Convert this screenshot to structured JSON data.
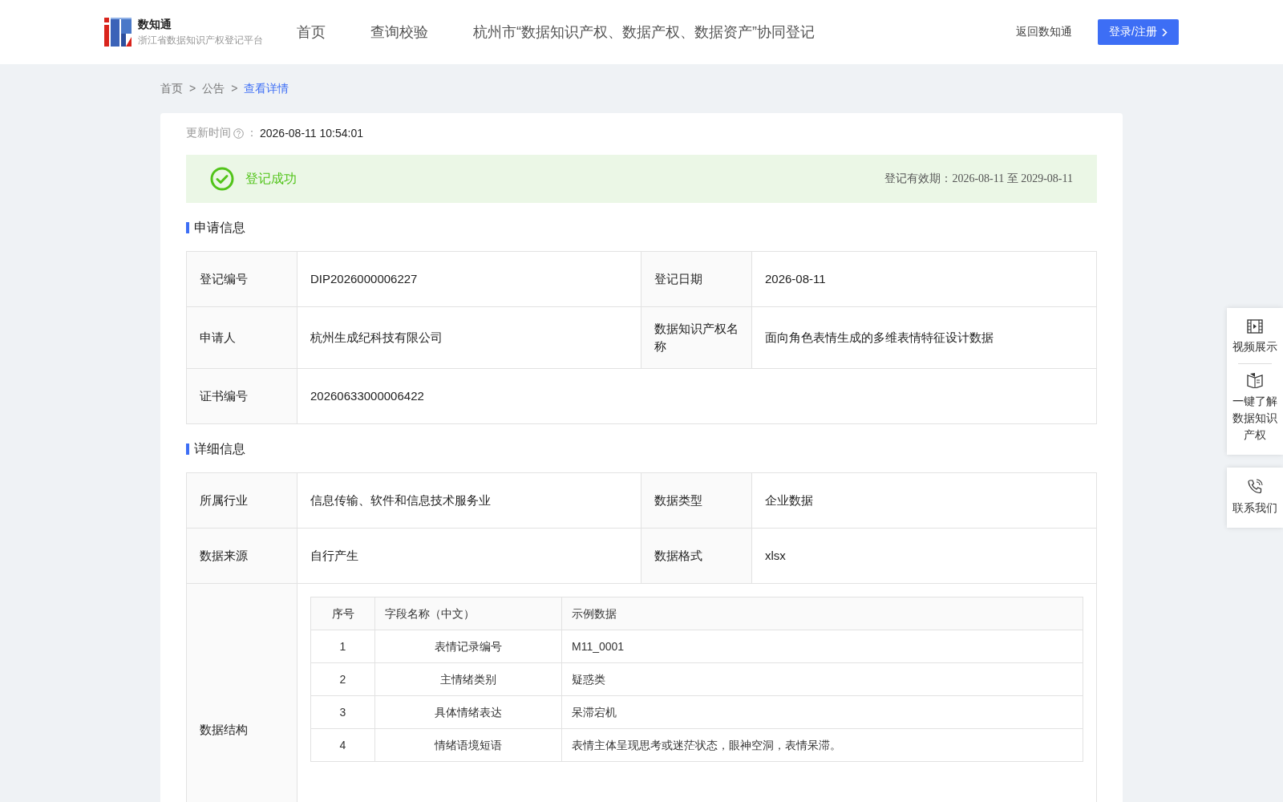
{
  "header": {
    "logo": {
      "name": "数知通",
      "subtitle": "浙江省数据知识产权登记平台"
    },
    "nav": [
      {
        "label": "首页",
        "selected": false
      },
      {
        "label": "查询校验",
        "selected": false
      },
      {
        "label": "杭州市“数据知识产权、数据产权、数据资产”协同登记",
        "selected": false
      }
    ],
    "back_link": "返回数知通",
    "login_button": "登录/注册"
  },
  "breadcrumb": {
    "separator": ">",
    "items": [
      {
        "label": "首页",
        "selected": false
      },
      {
        "label": "公告",
        "selected": false
      },
      {
        "label": "查看详情",
        "selected": true
      }
    ]
  },
  "update": {
    "label": "更新时间",
    "colon": "：",
    "value": "2026-08-11 10:54:01"
  },
  "status": {
    "text": "登记成功",
    "validity": "登记有效期：2026-08-11 至 2029-08-11"
  },
  "sections": [
    {
      "title": "申请信息",
      "rows": [
        {
          "kind": "pairs",
          "cells": [
            {
              "label": "登记编号",
              "value": "DIP2026000006227"
            },
            {
              "label": "登记日期",
              "value": "2026-08-11"
            }
          ]
        },
        {
          "kind": "pairs",
          "cells": [
            {
              "label": "申请人",
              "value": "杭州生成纪科技有限公司"
            },
            {
              "label": "数据知识产权名称",
              "value": "面向角色表情生成的多维表情特征设计数据"
            }
          ]
        },
        {
          "kind": "pairs",
          "cells": [
            {
              "label": "证书编号",
              "value": "20260633000006422"
            }
          ]
        }
      ]
    },
    {
      "title": "详细信息",
      "rows": [
        {
          "kind": "pairs",
          "cells": [
            {
              "label": "所属行业",
              "value": "信息传输、软件和信息技术服务业"
            },
            {
              "label": "数据类型",
              "value": "企业数据"
            }
          ]
        },
        {
          "kind": "pairs",
          "cells": [
            {
              "label": "数据来源",
              "value": "自行产生"
            },
            {
              "label": "数据格式",
              "value": "xlsx"
            }
          ]
        },
        {
          "kind": "table",
          "label": "数据结构",
          "columns": [
            "序号",
            "字段名称（中文）",
            "示例数据"
          ],
          "rows": [
            [
              "1",
              "表情记录编号",
              "M11_0001"
            ],
            [
              "2",
              "主情绪类别",
              "疑惑类"
            ],
            [
              "3",
              "具体情绪表达",
              "呆滞宕机"
            ],
            [
              "4",
              "情绪语境短语",
              "表情主体呈现思考或迷茫状态，眼神空洞，表情呆滞。"
            ]
          ]
        }
      ]
    }
  ],
  "side_panel": {
    "groups": [
      [
        {
          "kind": "video",
          "label": "视频展示"
        },
        {
          "kind": "book",
          "label": "一键了解数据知识产权"
        }
      ],
      [
        {
          "kind": "phone",
          "label": "联系我们"
        }
      ]
    ]
  }
}
